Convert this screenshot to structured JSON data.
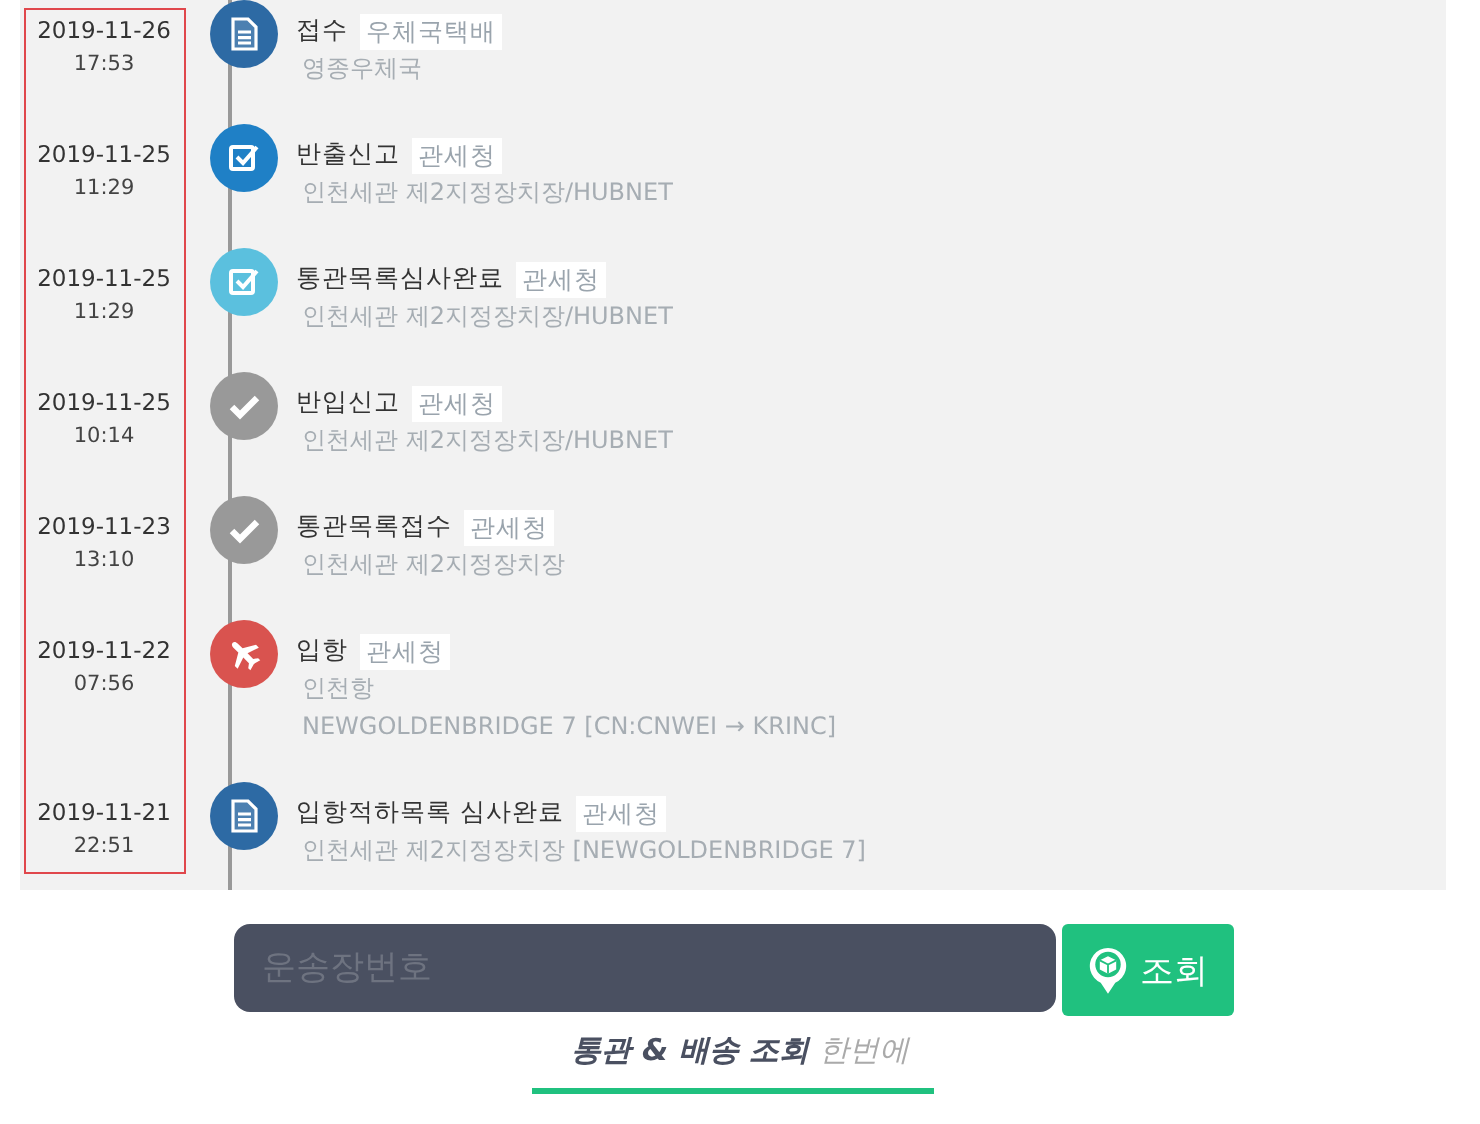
{
  "timeline": [
    {
      "date": "2019-11-26",
      "time": "17:53",
      "kind": "document",
      "color": "#2d6aa4",
      "status": "접수",
      "agency": "우체국택배",
      "details": [
        "영종우체국"
      ]
    },
    {
      "date": "2019-11-25",
      "time": "11:29",
      "kind": "checkbox",
      "color": "#1f80c6",
      "status": "반출신고",
      "agency": "관세청",
      "details": [
        "인천세관 제2지정장치장/HUBNET"
      ]
    },
    {
      "date": "2019-11-25",
      "time": "11:29",
      "kind": "checkbox",
      "color": "#5bc0de",
      "status": "통관목록심사완료",
      "agency": "관세청",
      "details": [
        "인천세관 제2지정장치장/HUBNET"
      ]
    },
    {
      "date": "2019-11-25",
      "time": "10:14",
      "kind": "check",
      "color": "#999999",
      "status": "반입신고",
      "agency": "관세청",
      "details": [
        "인천세관 제2지정장치장/HUBNET"
      ]
    },
    {
      "date": "2019-11-23",
      "time": "13:10",
      "kind": "check",
      "color": "#999999",
      "status": "통관목록접수",
      "agency": "관세청",
      "details": [
        "인천세관 제2지정장치장"
      ]
    },
    {
      "date": "2019-11-22",
      "time": "07:56",
      "kind": "plane",
      "color": "#d9534f",
      "status": "입항",
      "agency": "관세청",
      "details": [
        "인천항",
        "NEWGOLDENBRIDGE 7 [CN:CNWEI → KRINC]"
      ]
    },
    {
      "date": "2019-11-21",
      "time": "22:51",
      "kind": "document",
      "color": "#2d6aa4",
      "status": "입항적하목록 심사완료",
      "agency": "관세청",
      "details": [
        "인천세관 제2지정장치장 [NEWGOLDENBRIDGE 7]"
      ]
    }
  ],
  "search": {
    "placeholder": "운송장번호",
    "button": "조회"
  },
  "tagline": "**통관 & 배송 조회** 한번에"
}
